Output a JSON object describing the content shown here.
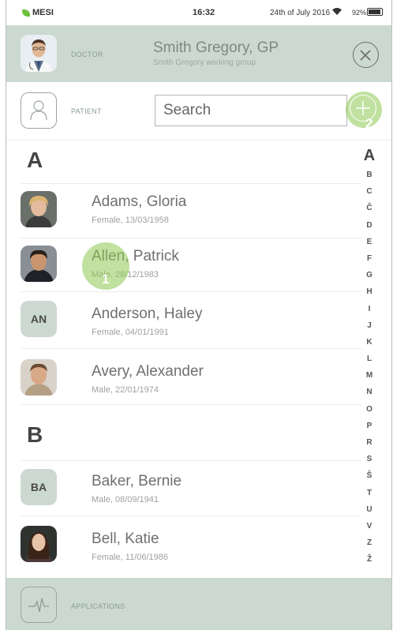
{
  "status_bar": {
    "carrier": "MESI",
    "time": "16:32",
    "date": "24th of July 2016",
    "battery": "92%",
    "battery_level": 0.92
  },
  "doctor": {
    "role_label": "DOCTOR",
    "name": "Smith Gregory, GP",
    "group": "Smith Gregory working group"
  },
  "patient": {
    "role_label": "PATIENT",
    "search_placeholder": "Search"
  },
  "sections": [
    {
      "letter": "A",
      "patients": [
        {
          "name": "Adams, Gloria",
          "info": "Female, 13/03/1958"
        },
        {
          "name": "Allen, Patrick",
          "info": "Male, 28/12/1983"
        },
        {
          "name": "Anderson, Haley",
          "info": "Female, 04/01/1991",
          "initials": "AN"
        },
        {
          "name": "Avery, Alexander",
          "info": "Male, 22/01/1974"
        }
      ]
    },
    {
      "letter": "B",
      "patients": [
        {
          "name": "Baker, Bernie",
          "info": "Male, 08/09/1941",
          "initials": "BA"
        },
        {
          "name": "Bell, Katie",
          "info": "Female, 11/06/1986"
        }
      ]
    }
  ],
  "alphabet_index": [
    "A",
    "B",
    "C",
    "Č",
    "D",
    "E",
    "F",
    "G",
    "H",
    "I",
    "J",
    "K",
    "L",
    "M",
    "N",
    "O",
    "P",
    "R",
    "S",
    "Š",
    "T",
    "U",
    "V",
    "Z",
    "Ž"
  ],
  "touch_markers": [
    "1",
    "2"
  ],
  "footer": {
    "label": "APPLICATIONS"
  },
  "colors": {
    "bar_bg": "#ccd9d1",
    "touch_green": "#8cc850",
    "brand_green": "#6fbf3e"
  }
}
